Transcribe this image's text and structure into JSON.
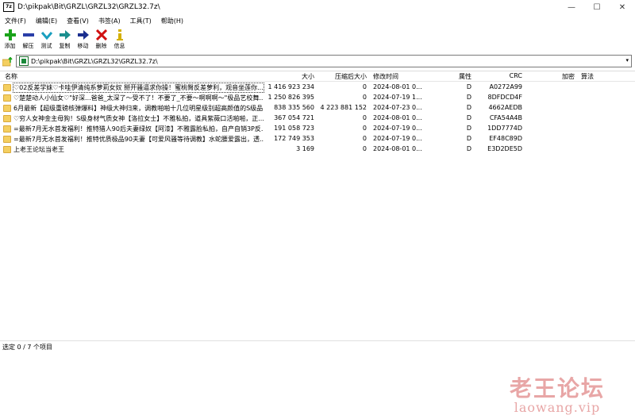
{
  "window": {
    "icon_text": "7z",
    "title": "D:\\pikpak\\Bit\\GRZL\\GRZL32\\GRZL32.7z\\"
  },
  "window_controls": {
    "minimize": "—",
    "maximize": "☐",
    "close": "✕"
  },
  "menu": [
    "文件(F)",
    "编辑(E)",
    "查看(V)",
    "书签(A)",
    "工具(T)",
    "帮助(H)"
  ],
  "toolbar": [
    {
      "label": "添加",
      "icon": "plus-icon",
      "color": "#1aa31a"
    },
    {
      "label": "解压",
      "icon": "minus-icon",
      "color": "#2a3ea8"
    },
    {
      "label": "测试",
      "icon": "checkmark-icon",
      "color": "#1a9fbf"
    },
    {
      "label": "复制",
      "icon": "copy-arrow-icon",
      "color": "#1a8f8f"
    },
    {
      "label": "移动",
      "icon": "move-arrow-icon",
      "color": "#1b2f8f"
    },
    {
      "label": "删除",
      "icon": "delete-x-icon",
      "color": "#d01010"
    },
    {
      "label": "信息",
      "icon": "info-icon",
      "color": "#d4b000"
    }
  ],
  "address": {
    "path": "D:\\pikpak\\Bit\\GRZL\\GRZL32\\GRZL32.7z\\"
  },
  "columns": {
    "name": "名称",
    "size": "大小",
    "packed": "压缩后大小",
    "modified": "修改时间",
    "attributes": "属性",
    "crc": "CRC",
    "encrypted": "加密",
    "method": "算法"
  },
  "rows": [
    {
      "name": "♡02反差学妹♡卡哇伊清纯系萝莉女奴 掰开骚逼求你操！蜜桃臀反差萝利，观音坐莲你...",
      "size": "1 416 923 234",
      "packed": "0",
      "modified": "2024-08-01 0...",
      "attr": "D",
      "crc": "A0272A99"
    },
    {
      "name": "♡楚楚动人小仙女♡\"好深...爸爸_太深了～受不了！不要了_不要～啊啊啊～\"极品艺校舞...",
      "size": "1 250 826 395",
      "packed": "0",
      "modified": "2024-07-19 1...",
      "attr": "D",
      "crc": "8DFDCD4F"
    },
    {
      "name": "6月最新【超级重磅核弹爆料】神级大神归来，调教啪啪十几位明星级别超高颜值的S级品...",
      "size": "838 335 560",
      "packed": "4 223 881 152",
      "modified": "2024-07-23 0...",
      "attr": "D",
      "crc": "4662AEDB"
    },
    {
      "name": "♡穷人女神金主母狗！S级身材气质女神【洛拉女士】不雅私拍，道具紫薇口活啪啪，正...",
      "size": "367 054 721",
      "packed": "0",
      "modified": "2024-08-01 0...",
      "attr": "D",
      "crc": "CFA54A4B"
    },
    {
      "name": "=最新7月无水首发福利！推特猎人90后夫妻绿奴【阿漆】不雅露脸私拍，自产自销3P反...",
      "size": "191 058 723",
      "packed": "0",
      "modified": "2024-07-19 0...",
      "attr": "D",
      "crc": "1DD7774D"
    },
    {
      "name": "=最新7月无水首发福利！推特优质极品90夫妻【可爱风骚等待调教】水蛇腰爱露出，透...",
      "size": "172 749 353",
      "packed": "0",
      "modified": "2024-07-19 0...",
      "attr": "D",
      "crc": "EF48C89D"
    },
    {
      "name": "上老王论坛当老王",
      "size": "3 169",
      "packed": "0",
      "modified": "2024-08-01 0...",
      "attr": "D",
      "crc": "E3D2DE5D"
    }
  ],
  "status": {
    "text": "选定 0 / 7 个项目"
  },
  "watermark": {
    "cn": "老王论坛",
    "en": "laowang.vip"
  }
}
